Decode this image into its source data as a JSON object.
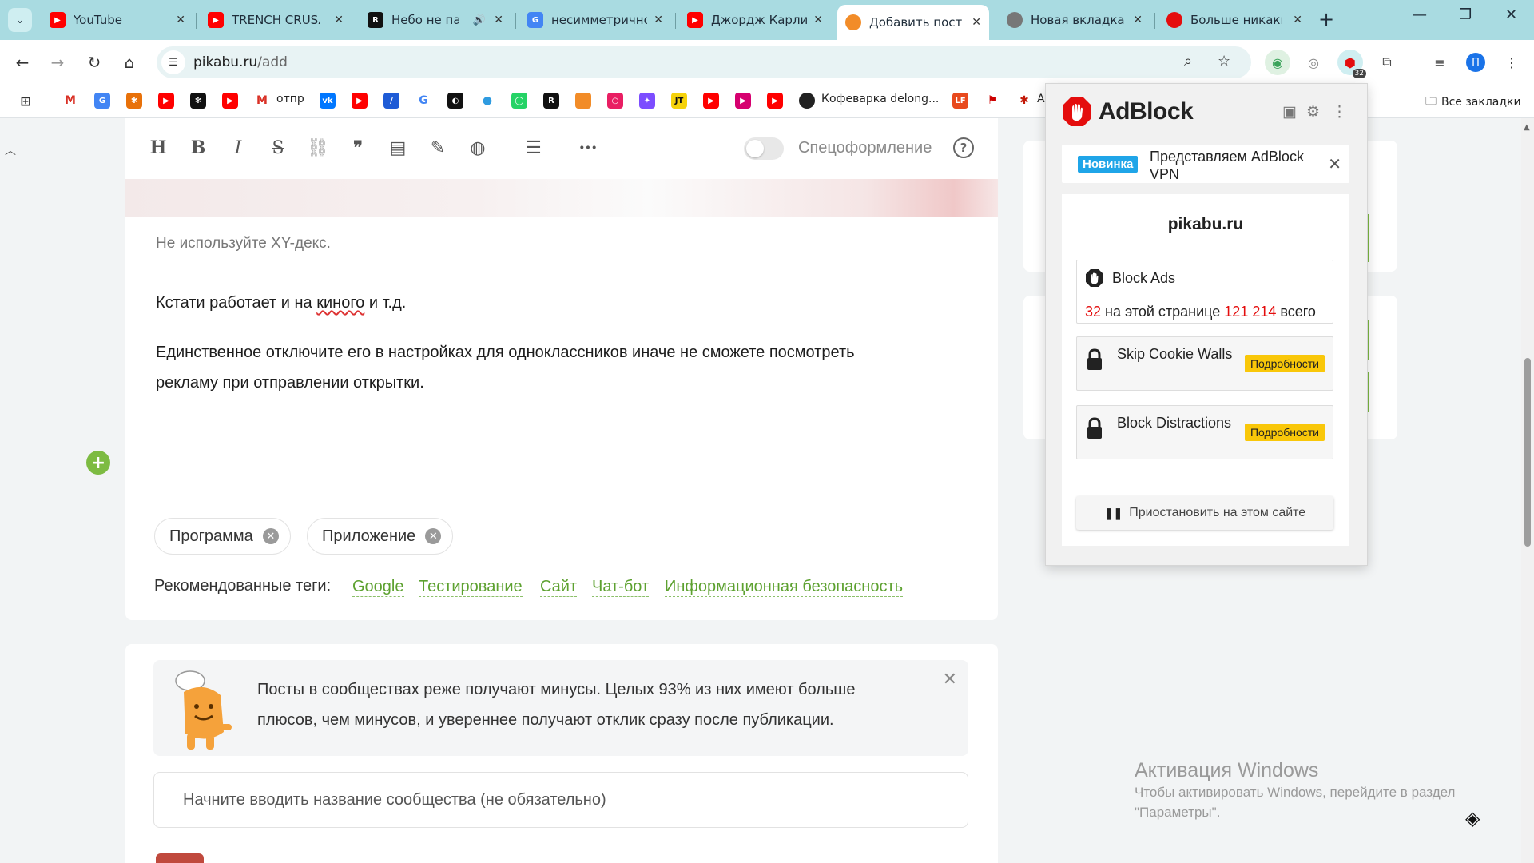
{
  "tabs": [
    {
      "title": "YouTube",
      "icon": "youtube-icon",
      "color": "#ff0000"
    },
    {
      "title": "TRENCH CRUSADE",
      "icon": "youtube-icon",
      "color": "#ff0000"
    },
    {
      "title": "Небо не падает",
      "icon": "r-app-icon",
      "color": "#111111",
      "audio": "speaker-icon"
    },
    {
      "title": "несимметрично",
      "icon": "google-icon",
      "color": "#4285f4"
    },
    {
      "title": "Джордж Карлин",
      "icon": "youtube-icon",
      "color": "#ff0000"
    },
    {
      "title": "Добавить пост |",
      "icon": "pikabu-icon",
      "color": "#f28c28",
      "active": true
    },
    {
      "title": "Новая вкладка",
      "icon": "chrome-icon",
      "color": "#777777"
    },
    {
      "title": "Больше никаких",
      "icon": "adblock-icon",
      "color": "#e40d0d"
    }
  ],
  "address": {
    "domain": "pikabu.ru",
    "path": "/add"
  },
  "profile_initial": "П",
  "extension_badge": "32",
  "bookmarks": {
    "gmail_label": "отпр",
    "coffee_label": "Кофеварка delong...",
    "cut_label": "A",
    "all_bookmarks": "Все закладки"
  },
  "editor": {
    "spec_label": "Спецоформление",
    "hint": "Не используйте XY-декс.",
    "para1_a": "Кстати работает и на ",
    "para1_b": "киного",
    "para1_c": " и т.д.",
    "para2_line1": "Единственное отключите его в настройках для одноклассников иначе не сможете посмотреть",
    "para2_line2": "рекламу  при отправлении открытки.",
    "tags": [
      "Программа",
      "Приложение"
    ],
    "recommended_label": "Рекомендованные теги:",
    "recommended": [
      "Google",
      "Тестирование",
      "Сайт",
      "Чат-бот",
      "Информационная безопасность"
    ]
  },
  "notice": {
    "line1": "Посты в сообществах реже получают минусы. Целых 93% из них имеют больше",
    "line2": "плюсов, чем минусов, и увереннее получают отклик сразу после публикации."
  },
  "community_placeholder": "Начните вводить название сообщества (не обязательно)",
  "adblock": {
    "brand": "AdBlock",
    "news_badge": "Новинка",
    "news_text": "Представляем AdBlock VPN",
    "site": "pikabu.ru",
    "block_title": "Block Ads",
    "page_count": "32",
    "page_label": "на этой странице",
    "total_count": "121 214",
    "total_label": "всего",
    "feature1": "Skip Cookie Walls",
    "feature2": "Block Distractions",
    "more_label": "Подробности",
    "pause_label": "Приостановить на этом сайте",
    "accent": "#e40d0d"
  },
  "windows": {
    "title": "Активация Windows",
    "line1": "Чтобы активировать Windows, перейдите в раздел",
    "line2": "\"Параметры\"."
  }
}
